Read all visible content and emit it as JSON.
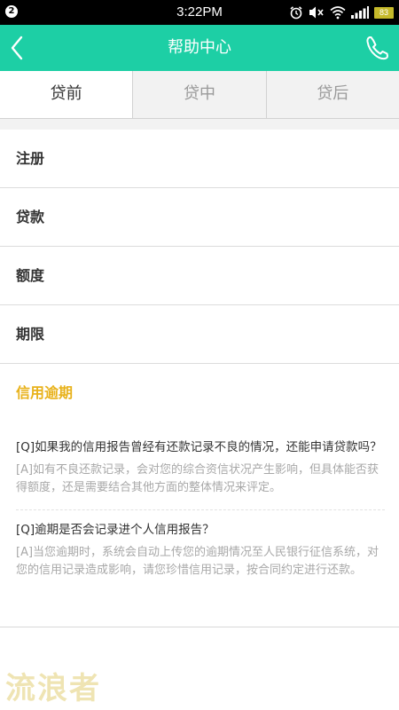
{
  "status_bar": {
    "notification_count": "2",
    "time": "3:22PM",
    "battery_level": "83",
    "icons": [
      "alarm-icon",
      "mute-icon",
      "wifi-icon",
      "signal-icon",
      "battery-icon"
    ]
  },
  "header": {
    "title": "帮助中心",
    "back_icon": "chevron-left-icon",
    "phone_icon": "phone-icon",
    "color": "#1dcfa5"
  },
  "tabs": [
    {
      "label": "贷前",
      "active": true
    },
    {
      "label": "贷中",
      "active": false
    },
    {
      "label": "贷后",
      "active": false
    }
  ],
  "categories": [
    {
      "label": "注册"
    },
    {
      "label": "贷款"
    },
    {
      "label": "额度"
    },
    {
      "label": "期限"
    },
    {
      "label": "信用逾期",
      "highlight_color": "#e8b21b"
    }
  ],
  "faq": [
    {
      "question": "[Q]如果我的信用报告曾经有还款记录不良的情况，还能申请贷款吗？",
      "answer": "[A]如有不良还款记录，会对您的综合资信状况产生影响，但具体能否获得额度，还是需要结合其他方面的整体情况来评定。"
    },
    {
      "question": "[Q]逾期是否会记录进个人信用报告？",
      "answer": "[A]当您逾期时，系统会自动上传您的逾期情况至人民银行征信系统，对您的信用记录造成影响，请您珍惜信用记录，按合同约定进行还款。"
    }
  ],
  "watermark": "流浪者"
}
